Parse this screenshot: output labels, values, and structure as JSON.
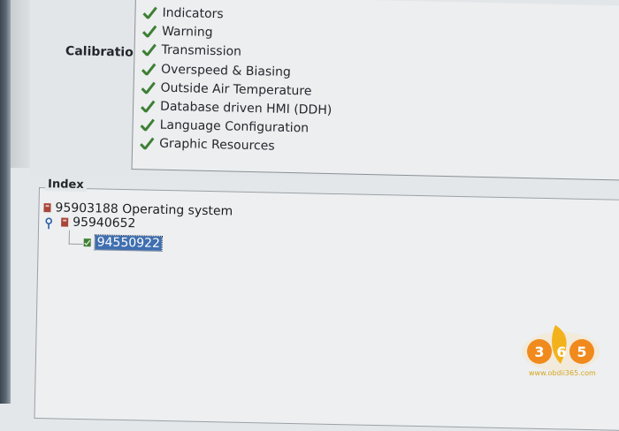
{
  "calibration": {
    "label": "Calibration",
    "items": [
      "Indicators",
      "Warning",
      "Transmission",
      "Overspeed & Biasing",
      "Outside Air Temperature",
      "Database driven HMI (DDH)",
      "Language Configuration",
      "Graphic Resources"
    ]
  },
  "index": {
    "title": "Index",
    "tree": {
      "root": "95903188 Operating system",
      "child": "95940652",
      "grandchild": "94550922"
    }
  },
  "watermark": {
    "logo_text": "365",
    "url": "www.obdii365.com"
  },
  "colors": {
    "check": "#3e7f34",
    "node_icon": "#a8463a",
    "selection": "#3f6fb0",
    "logo_orange": "#f08a1c"
  }
}
